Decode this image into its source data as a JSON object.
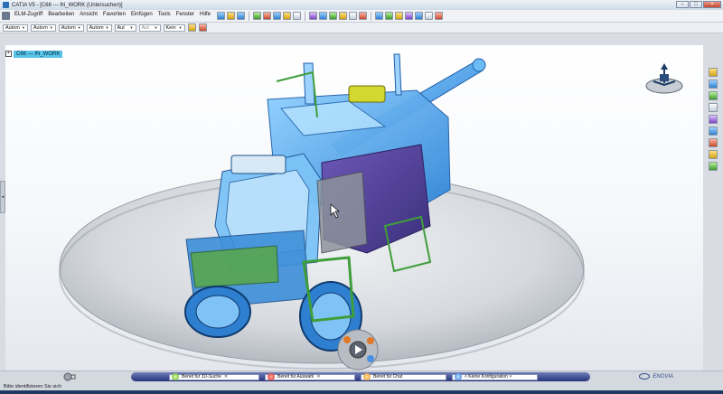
{
  "window": {
    "title": "CATIA V5 - [C66 --- IN_WORK (Untersuchen)]",
    "controls": [
      "minimize",
      "maximize",
      "close"
    ]
  },
  "menu": {
    "items": [
      "ELM-Zugriff",
      "Bearbeiten",
      "Ansicht",
      "Favoriten",
      "Einfügen",
      "Tools",
      "Fenster",
      "Hilfe"
    ],
    "leading_icon": "catia-logo-icon"
  },
  "toolbar2": {
    "dropdowns": [
      {
        "value": "Autom"
      },
      {
        "value": "Autom"
      },
      {
        "value": "Autom"
      },
      {
        "value": "Autom"
      },
      {
        "value": "Aut"
      },
      {
        "value": "Aut"
      },
      {
        "value": "Kein"
      }
    ]
  },
  "tree": {
    "root_label": "C66 --- IN_WORK"
  },
  "status": {
    "prompt": "Bitte identifizieren Sie sich",
    "chat": {
      "search_status": "Bereit für 3D-Suche",
      "selection_status": "Bereit für Auswahl",
      "chat_status": "Bereit für Chat",
      "configuration": "< Keine Konfiguration >"
    },
    "logo_text": "ENOVIA"
  },
  "colors": {
    "accent": "#5ac3e8",
    "model_blue": "#4fa6ea",
    "model_purple": "#5b4a9c",
    "model_green": "#3f9e3a",
    "platform": "#d7dbe0"
  }
}
